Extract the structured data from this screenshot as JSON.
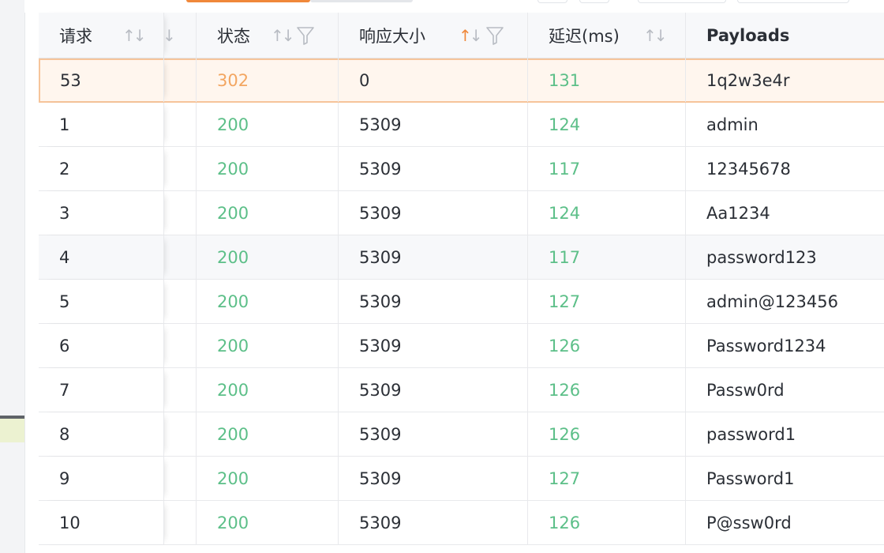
{
  "table": {
    "columns": [
      {
        "key": "req",
        "label": "请求",
        "sort": "none",
        "filter": false
      },
      {
        "key": "hidden",
        "label": "",
        "sort": "desc-partial",
        "filter": false
      },
      {
        "key": "status",
        "label": "状态",
        "sort": "none",
        "filter": true
      },
      {
        "key": "size",
        "label": "响应大小",
        "sort": "asc",
        "filter": true
      },
      {
        "key": "latency",
        "label": "延迟(ms)",
        "sort": "none",
        "filter": false
      },
      {
        "key": "payloads",
        "label": "Payloads",
        "sort": "none",
        "filter": false
      }
    ],
    "rows": [
      {
        "req": "53",
        "status": "302",
        "size": "0",
        "latency": "131",
        "payload": "1q2w3e4r",
        "selected": true
      },
      {
        "req": "1",
        "status": "200",
        "size": "5309",
        "latency": "124",
        "payload": "admin"
      },
      {
        "req": "2",
        "status": "200",
        "size": "5309",
        "latency": "117",
        "payload": "12345678"
      },
      {
        "req": "3",
        "status": "200",
        "size": "5309",
        "latency": "124",
        "payload": "Aa1234"
      },
      {
        "req": "4",
        "status": "200",
        "size": "5309",
        "latency": "117",
        "payload": "password123",
        "hovered": true
      },
      {
        "req": "5",
        "status": "200",
        "size": "5309",
        "latency": "127",
        "payload": "admin@123456"
      },
      {
        "req": "6",
        "status": "200",
        "size": "5309",
        "latency": "126",
        "payload": "Password1234"
      },
      {
        "req": "7",
        "status": "200",
        "size": "5309",
        "latency": "126",
        "payload": "Passw0rd"
      },
      {
        "req": "8",
        "status": "200",
        "size": "5309",
        "latency": "126",
        "payload": "password1"
      },
      {
        "req": "9",
        "status": "200",
        "size": "5309",
        "latency": "127",
        "payload": "Password1"
      },
      {
        "req": "10",
        "status": "200",
        "size": "5309",
        "latency": "126",
        "payload": "P@ssw0rd"
      }
    ]
  },
  "colors": {
    "status_ok": "#5cbf88",
    "status_redirect": "#f3a661",
    "accent": "#f0883a",
    "selected_row_bg": "#fff6ee",
    "selected_row_border": "#f6c49a"
  },
  "icons": {
    "sort": "sort-arrows-icon",
    "filter": "filter-funnel-icon"
  }
}
